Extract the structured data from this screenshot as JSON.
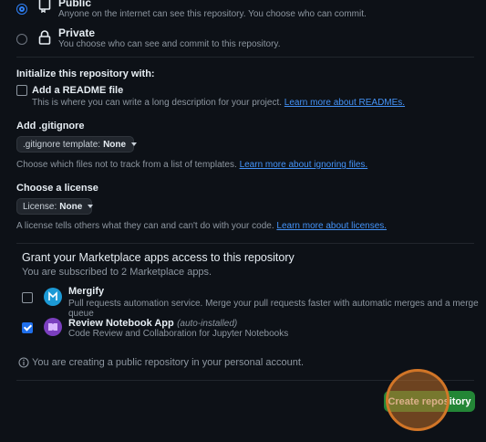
{
  "visibility": {
    "public": {
      "title": "Public",
      "description": "Anyone on the internet can see this repository. You choose who can commit."
    },
    "private": {
      "title": "Private",
      "description": "You choose who can see and commit to this repository."
    }
  },
  "initialize": {
    "heading": "Initialize this repository with:",
    "readme_label": "Add a README file",
    "readme_desc": "This is where you can write a long description for your project.",
    "readme_link": "Learn more about READMEs."
  },
  "gitignore": {
    "heading": "Add .gitignore",
    "dropdown_prefix": ".gitignore template:",
    "dropdown_value": "None",
    "desc": "Choose which files not to track from a list of templates.",
    "link": "Learn more about ignoring files."
  },
  "license": {
    "heading": "Choose a license",
    "dropdown_prefix": "License:",
    "dropdown_value": "None",
    "desc": "A license tells others what they can and can't do with your code.",
    "link": "Learn more about licenses."
  },
  "marketplace": {
    "heading": "Grant your Marketplace apps access to this repository",
    "subheading": "You are subscribed to 2 Marketplace apps.",
    "apps": [
      {
        "name": "Mergify",
        "note": "",
        "description": "Pull requests automation service. Merge your pull requests faster with automatic merges and a merge queue",
        "checked": false,
        "icon": "mergify-icon",
        "color": "#1c9ad6"
      },
      {
        "name": "Review Notebook App",
        "note": "(auto-installed)",
        "description": "Code Review and Collaboration for Jupyter Notebooks",
        "checked": true,
        "icon": "notebook-icon",
        "color": "#7b3fbf"
      }
    ]
  },
  "notice": "You are creating a public repository in your personal account.",
  "submit_label": "Create repository",
  "colors": {
    "background": "#0d1117",
    "accent_blue": "#2f81f7",
    "primary_green": "#238636",
    "link": "#4493f8"
  }
}
